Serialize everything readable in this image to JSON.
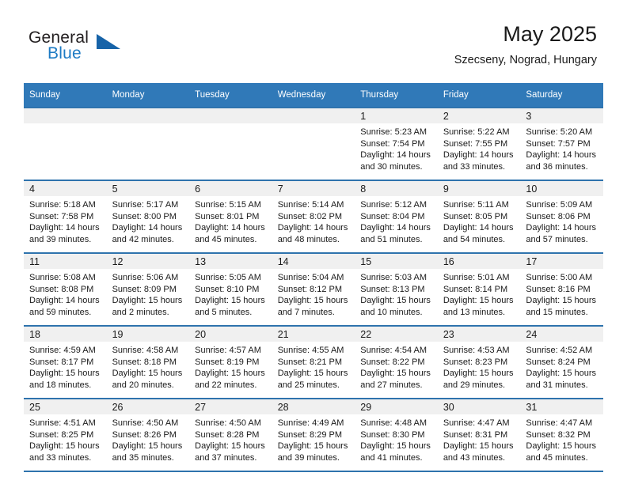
{
  "branding": {
    "logo_text_primary": "General",
    "logo_text_secondary": "Blue",
    "logo_icon": "triangle-flag-icon",
    "accent_color": "#1763a8",
    "secondary_color": "#1e7bc4"
  },
  "header": {
    "title": "May 2025",
    "subtitle": "Szecseny, Nograd, Hungary"
  },
  "theme": {
    "header_row_bg": "#3079b8",
    "header_row_text": "#ffffff",
    "row_divider": "#2e73ad",
    "daynum_band_bg": "#f0f0f0",
    "cell_bg": "#ffffff",
    "text_color": "#1a1a1a"
  },
  "weekday_headers": [
    "Sunday",
    "Monday",
    "Tuesday",
    "Wednesday",
    "Thursday",
    "Friday",
    "Saturday"
  ],
  "weeks": [
    [
      {
        "day": "",
        "empty": true,
        "lines": []
      },
      {
        "day": "",
        "empty": true,
        "lines": []
      },
      {
        "day": "",
        "empty": true,
        "lines": []
      },
      {
        "day": "",
        "empty": true,
        "lines": []
      },
      {
        "day": "1",
        "empty": false,
        "lines": [
          "Sunrise: 5:23 AM",
          "Sunset: 7:54 PM",
          "Daylight: 14 hours",
          "and 30 minutes."
        ]
      },
      {
        "day": "2",
        "empty": false,
        "lines": [
          "Sunrise: 5:22 AM",
          "Sunset: 7:55 PM",
          "Daylight: 14 hours",
          "and 33 minutes."
        ]
      },
      {
        "day": "3",
        "empty": false,
        "lines": [
          "Sunrise: 5:20 AM",
          "Sunset: 7:57 PM",
          "Daylight: 14 hours",
          "and 36 minutes."
        ]
      }
    ],
    [
      {
        "day": "4",
        "empty": false,
        "lines": [
          "Sunrise: 5:18 AM",
          "Sunset: 7:58 PM",
          "Daylight: 14 hours",
          "and 39 minutes."
        ]
      },
      {
        "day": "5",
        "empty": false,
        "lines": [
          "Sunrise: 5:17 AM",
          "Sunset: 8:00 PM",
          "Daylight: 14 hours",
          "and 42 minutes."
        ]
      },
      {
        "day": "6",
        "empty": false,
        "lines": [
          "Sunrise: 5:15 AM",
          "Sunset: 8:01 PM",
          "Daylight: 14 hours",
          "and 45 minutes."
        ]
      },
      {
        "day": "7",
        "empty": false,
        "lines": [
          "Sunrise: 5:14 AM",
          "Sunset: 8:02 PM",
          "Daylight: 14 hours",
          "and 48 minutes."
        ]
      },
      {
        "day": "8",
        "empty": false,
        "lines": [
          "Sunrise: 5:12 AM",
          "Sunset: 8:04 PM",
          "Daylight: 14 hours",
          "and 51 minutes."
        ]
      },
      {
        "day": "9",
        "empty": false,
        "lines": [
          "Sunrise: 5:11 AM",
          "Sunset: 8:05 PM",
          "Daylight: 14 hours",
          "and 54 minutes."
        ]
      },
      {
        "day": "10",
        "empty": false,
        "lines": [
          "Sunrise: 5:09 AM",
          "Sunset: 8:06 PM",
          "Daylight: 14 hours",
          "and 57 minutes."
        ]
      }
    ],
    [
      {
        "day": "11",
        "empty": false,
        "lines": [
          "Sunrise: 5:08 AM",
          "Sunset: 8:08 PM",
          "Daylight: 14 hours",
          "and 59 minutes."
        ]
      },
      {
        "day": "12",
        "empty": false,
        "lines": [
          "Sunrise: 5:06 AM",
          "Sunset: 8:09 PM",
          "Daylight: 15 hours",
          "and 2 minutes."
        ]
      },
      {
        "day": "13",
        "empty": false,
        "lines": [
          "Sunrise: 5:05 AM",
          "Sunset: 8:10 PM",
          "Daylight: 15 hours",
          "and 5 minutes."
        ]
      },
      {
        "day": "14",
        "empty": false,
        "lines": [
          "Sunrise: 5:04 AM",
          "Sunset: 8:12 PM",
          "Daylight: 15 hours",
          "and 7 minutes."
        ]
      },
      {
        "day": "15",
        "empty": false,
        "lines": [
          "Sunrise: 5:03 AM",
          "Sunset: 8:13 PM",
          "Daylight: 15 hours",
          "and 10 minutes."
        ]
      },
      {
        "day": "16",
        "empty": false,
        "lines": [
          "Sunrise: 5:01 AM",
          "Sunset: 8:14 PM",
          "Daylight: 15 hours",
          "and 13 minutes."
        ]
      },
      {
        "day": "17",
        "empty": false,
        "lines": [
          "Sunrise: 5:00 AM",
          "Sunset: 8:16 PM",
          "Daylight: 15 hours",
          "and 15 minutes."
        ]
      }
    ],
    [
      {
        "day": "18",
        "empty": false,
        "lines": [
          "Sunrise: 4:59 AM",
          "Sunset: 8:17 PM",
          "Daylight: 15 hours",
          "and 18 minutes."
        ]
      },
      {
        "day": "19",
        "empty": false,
        "lines": [
          "Sunrise: 4:58 AM",
          "Sunset: 8:18 PM",
          "Daylight: 15 hours",
          "and 20 minutes."
        ]
      },
      {
        "day": "20",
        "empty": false,
        "lines": [
          "Sunrise: 4:57 AM",
          "Sunset: 8:19 PM",
          "Daylight: 15 hours",
          "and 22 minutes."
        ]
      },
      {
        "day": "21",
        "empty": false,
        "lines": [
          "Sunrise: 4:55 AM",
          "Sunset: 8:21 PM",
          "Daylight: 15 hours",
          "and 25 minutes."
        ]
      },
      {
        "day": "22",
        "empty": false,
        "lines": [
          "Sunrise: 4:54 AM",
          "Sunset: 8:22 PM",
          "Daylight: 15 hours",
          "and 27 minutes."
        ]
      },
      {
        "day": "23",
        "empty": false,
        "lines": [
          "Sunrise: 4:53 AM",
          "Sunset: 8:23 PM",
          "Daylight: 15 hours",
          "and 29 minutes."
        ]
      },
      {
        "day": "24",
        "empty": false,
        "lines": [
          "Sunrise: 4:52 AM",
          "Sunset: 8:24 PM",
          "Daylight: 15 hours",
          "and 31 minutes."
        ]
      }
    ],
    [
      {
        "day": "25",
        "empty": false,
        "lines": [
          "Sunrise: 4:51 AM",
          "Sunset: 8:25 PM",
          "Daylight: 15 hours",
          "and 33 minutes."
        ]
      },
      {
        "day": "26",
        "empty": false,
        "lines": [
          "Sunrise: 4:50 AM",
          "Sunset: 8:26 PM",
          "Daylight: 15 hours",
          "and 35 minutes."
        ]
      },
      {
        "day": "27",
        "empty": false,
        "lines": [
          "Sunrise: 4:50 AM",
          "Sunset: 8:28 PM",
          "Daylight: 15 hours",
          "and 37 minutes."
        ]
      },
      {
        "day": "28",
        "empty": false,
        "lines": [
          "Sunrise: 4:49 AM",
          "Sunset: 8:29 PM",
          "Daylight: 15 hours",
          "and 39 minutes."
        ]
      },
      {
        "day": "29",
        "empty": false,
        "lines": [
          "Sunrise: 4:48 AM",
          "Sunset: 8:30 PM",
          "Daylight: 15 hours",
          "and 41 minutes."
        ]
      },
      {
        "day": "30",
        "empty": false,
        "lines": [
          "Sunrise: 4:47 AM",
          "Sunset: 8:31 PM",
          "Daylight: 15 hours",
          "and 43 minutes."
        ]
      },
      {
        "day": "31",
        "empty": false,
        "lines": [
          "Sunrise: 4:47 AM",
          "Sunset: 8:32 PM",
          "Daylight: 15 hours",
          "and 45 minutes."
        ]
      }
    ]
  ]
}
